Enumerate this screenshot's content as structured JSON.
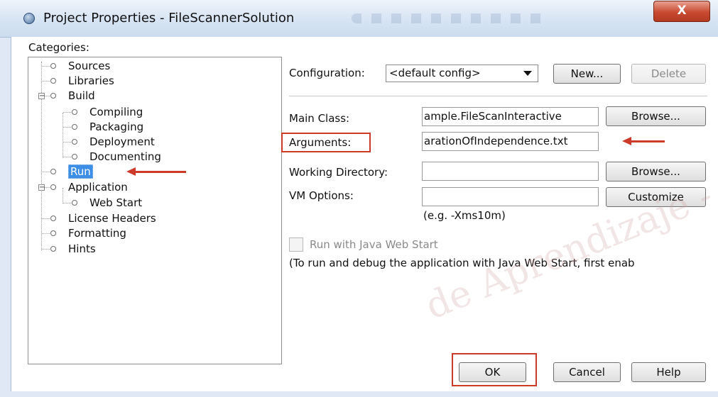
{
  "window": {
    "title": "Project Properties - FileScannerSolution",
    "close_label": "X"
  },
  "categories": {
    "label": "Categories:",
    "items": [
      {
        "label": "Sources"
      },
      {
        "label": "Libraries"
      },
      {
        "label": "Build"
      },
      {
        "label": "Compiling"
      },
      {
        "label": "Packaging"
      },
      {
        "label": "Deployment"
      },
      {
        "label": "Documenting"
      },
      {
        "label": "Run",
        "selected": true
      },
      {
        "label": "Application"
      },
      {
        "label": "Web Start"
      },
      {
        "label": "License Headers"
      },
      {
        "label": "Formatting"
      },
      {
        "label": "Hints"
      }
    ]
  },
  "configuration": {
    "label": "Configuration:",
    "selected": "<default config>",
    "new_label": "New...",
    "delete_label": "Delete"
  },
  "run": {
    "main_class_label": "Main Class:",
    "main_class_value": "ample.FileScanInteractive",
    "browse_label": "Browse...",
    "arguments_label": "Arguments:",
    "arguments_value": "arationOfIndependence.txt",
    "working_dir_label": "Working Directory:",
    "working_dir_value": "",
    "browse2_label": "Browse...",
    "vm_options_label": "VM Options:",
    "vm_options_value": "",
    "customize_label": "Customize",
    "vm_hint": "(e.g. -Xms10m)",
    "webstart_label": "Run with Java Web Start",
    "webstart_checked": false,
    "webstart_note": "(To run and debug the application with Java Web Start, first enab"
  },
  "footer": {
    "ok_label": "OK",
    "cancel_label": "Cancel",
    "help_label": "Help"
  },
  "watermark": "de Aprendizaje -",
  "colors": {
    "accent_red": "#cc3a2a",
    "selection_blue": "#3c8ee7"
  }
}
